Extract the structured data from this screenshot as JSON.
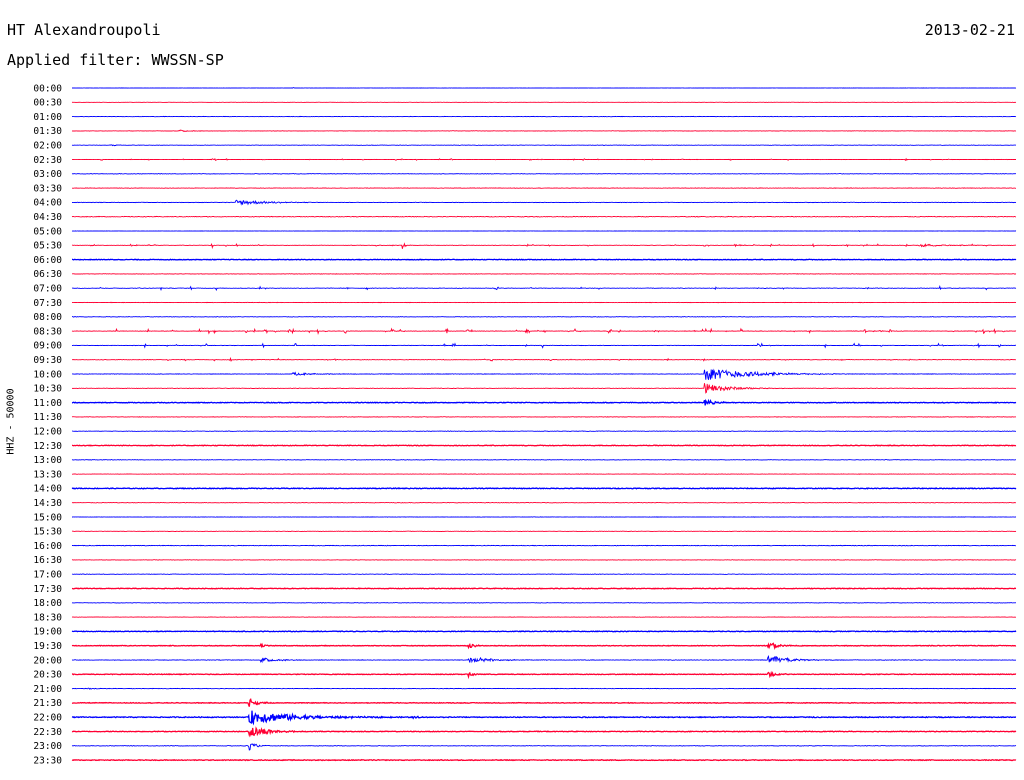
{
  "header": {
    "station": "HT Alexandroupoli",
    "filter": "Applied filter: WWSSN-SP",
    "date": "2013-02-21"
  },
  "chart_data": {
    "type": "line",
    "ylabel": "HHZ - 50000",
    "ticks": [
      "00:00",
      "00:30",
      "01:00",
      "01:30",
      "02:00",
      "02:30",
      "03:00",
      "03:30",
      "04:00",
      "04:30",
      "05:00",
      "05:30",
      "06:00",
      "06:30",
      "07:00",
      "07:30",
      "08:00",
      "08:30",
      "09:00",
      "09:30",
      "10:00",
      "10:30",
      "11:00",
      "11:30",
      "12:00",
      "12:30",
      "13:00",
      "13:30",
      "14:00",
      "14:30",
      "15:00",
      "15:30",
      "16:00",
      "16:30",
      "17:00",
      "17:30",
      "18:00",
      "18:30",
      "19:00",
      "19:30",
      "20:00",
      "20:30",
      "21:00",
      "21:30",
      "22:00",
      "22:30",
      "23:00",
      "23:30"
    ],
    "colors": {
      "even": "#0000ff",
      "odd": "#ff0033"
    },
    "x_range_minutes": [
      0,
      30
    ],
    "amplitude_range": [
      -4,
      4
    ],
    "noise_levels": [
      0.3,
      0.3,
      0.5,
      0.5,
      0.5,
      0.3,
      0.6,
      0.6,
      0.6,
      0.8,
      0.4,
      0.5,
      0.9,
      0.6,
      0.6,
      0.5,
      0.6,
      0.6,
      0.5,
      0.6,
      0.7,
      0.6,
      1.0,
      0.6,
      0.6,
      0.9,
      0.6,
      0.5,
      1.1,
      0.6,
      0.5,
      0.5,
      0.8,
      0.6,
      0.6,
      0.9,
      0.6,
      0.5,
      1.0,
      0.9,
      0.8,
      1.0,
      0.6,
      0.9,
      1.2,
      0.9,
      0.7,
      1.1
    ],
    "events": [
      {
        "trace": 0,
        "t": 1.5,
        "amp": 0.3,
        "dur": 0.2
      },
      {
        "trace": 0,
        "t": 7.0,
        "amp": 0.4,
        "dur": 0.1
      },
      {
        "trace": 3,
        "t": 3.4,
        "amp": 0.6,
        "dur": 0.8
      },
      {
        "trace": 4,
        "t": 1.2,
        "amp": 0.4,
        "dur": 0.6
      },
      {
        "trace": 8,
        "t": 5.2,
        "amp": 1.6,
        "dur": 1.8
      },
      {
        "trace": 10,
        "t": 25.0,
        "amp": 0.5,
        "dur": 0.1
      },
      {
        "trace": 11,
        "t": 10.5,
        "amp": 2.0,
        "dur": 0.2
      },
      {
        "trace": 11,
        "t": 27.0,
        "amp": 0.8,
        "dur": 1.5
      },
      {
        "trace": 20,
        "t": 20.1,
        "amp": 3.5,
        "dur": 3.0
      },
      {
        "trace": 21,
        "t": 20.1,
        "amp": 3.0,
        "dur": 1.5
      },
      {
        "trace": 22,
        "t": 20.1,
        "amp": 1.5,
        "dur": 0.8
      },
      {
        "trace": 20,
        "t": 7.0,
        "amp": 0.8,
        "dur": 1.5
      },
      {
        "trace": 40,
        "t": 6.0,
        "amp": 1.5,
        "dur": 1.0
      },
      {
        "trace": 40,
        "t": 12.6,
        "amp": 2.2,
        "dur": 1.2
      },
      {
        "trace": 40,
        "t": 22.1,
        "amp": 2.5,
        "dur": 1.4
      },
      {
        "trace": 39,
        "t": 6.0,
        "amp": 1.0,
        "dur": 0.4
      },
      {
        "trace": 39,
        "t": 12.6,
        "amp": 1.2,
        "dur": 0.5
      },
      {
        "trace": 39,
        "t": 22.1,
        "amp": 2.6,
        "dur": 0.6
      },
      {
        "trace": 41,
        "t": 12.6,
        "amp": 1.4,
        "dur": 0.4
      },
      {
        "trace": 41,
        "t": 22.1,
        "amp": 1.8,
        "dur": 0.5
      },
      {
        "trace": 43,
        "t": 5.6,
        "amp": 3.0,
        "dur": 0.5
      },
      {
        "trace": 44,
        "t": 5.6,
        "amp": 3.8,
        "dur": 3.0
      },
      {
        "trace": 45,
        "t": 5.6,
        "amp": 3.5,
        "dur": 1.2
      },
      {
        "trace": 46,
        "t": 5.6,
        "amp": 2.8,
        "dur": 0.4
      },
      {
        "trace": 44,
        "t": 10.8,
        "amp": 0.6,
        "dur": 0.5
      },
      {
        "trace": 42,
        "t": 0.5,
        "amp": 0.3,
        "dur": 0.6
      }
    ],
    "spike_traces": [
      {
        "trace": 5,
        "count": 40,
        "amp": 0.4
      },
      {
        "trace": 11,
        "count": 40,
        "amp": 0.6
      },
      {
        "trace": 14,
        "count": 25,
        "amp": 0.8
      },
      {
        "trace": 17,
        "count": 70,
        "amp": 0.9
      },
      {
        "trace": 18,
        "count": 30,
        "amp": 1.0
      },
      {
        "trace": 19,
        "count": 25,
        "amp": 0.5
      }
    ]
  }
}
